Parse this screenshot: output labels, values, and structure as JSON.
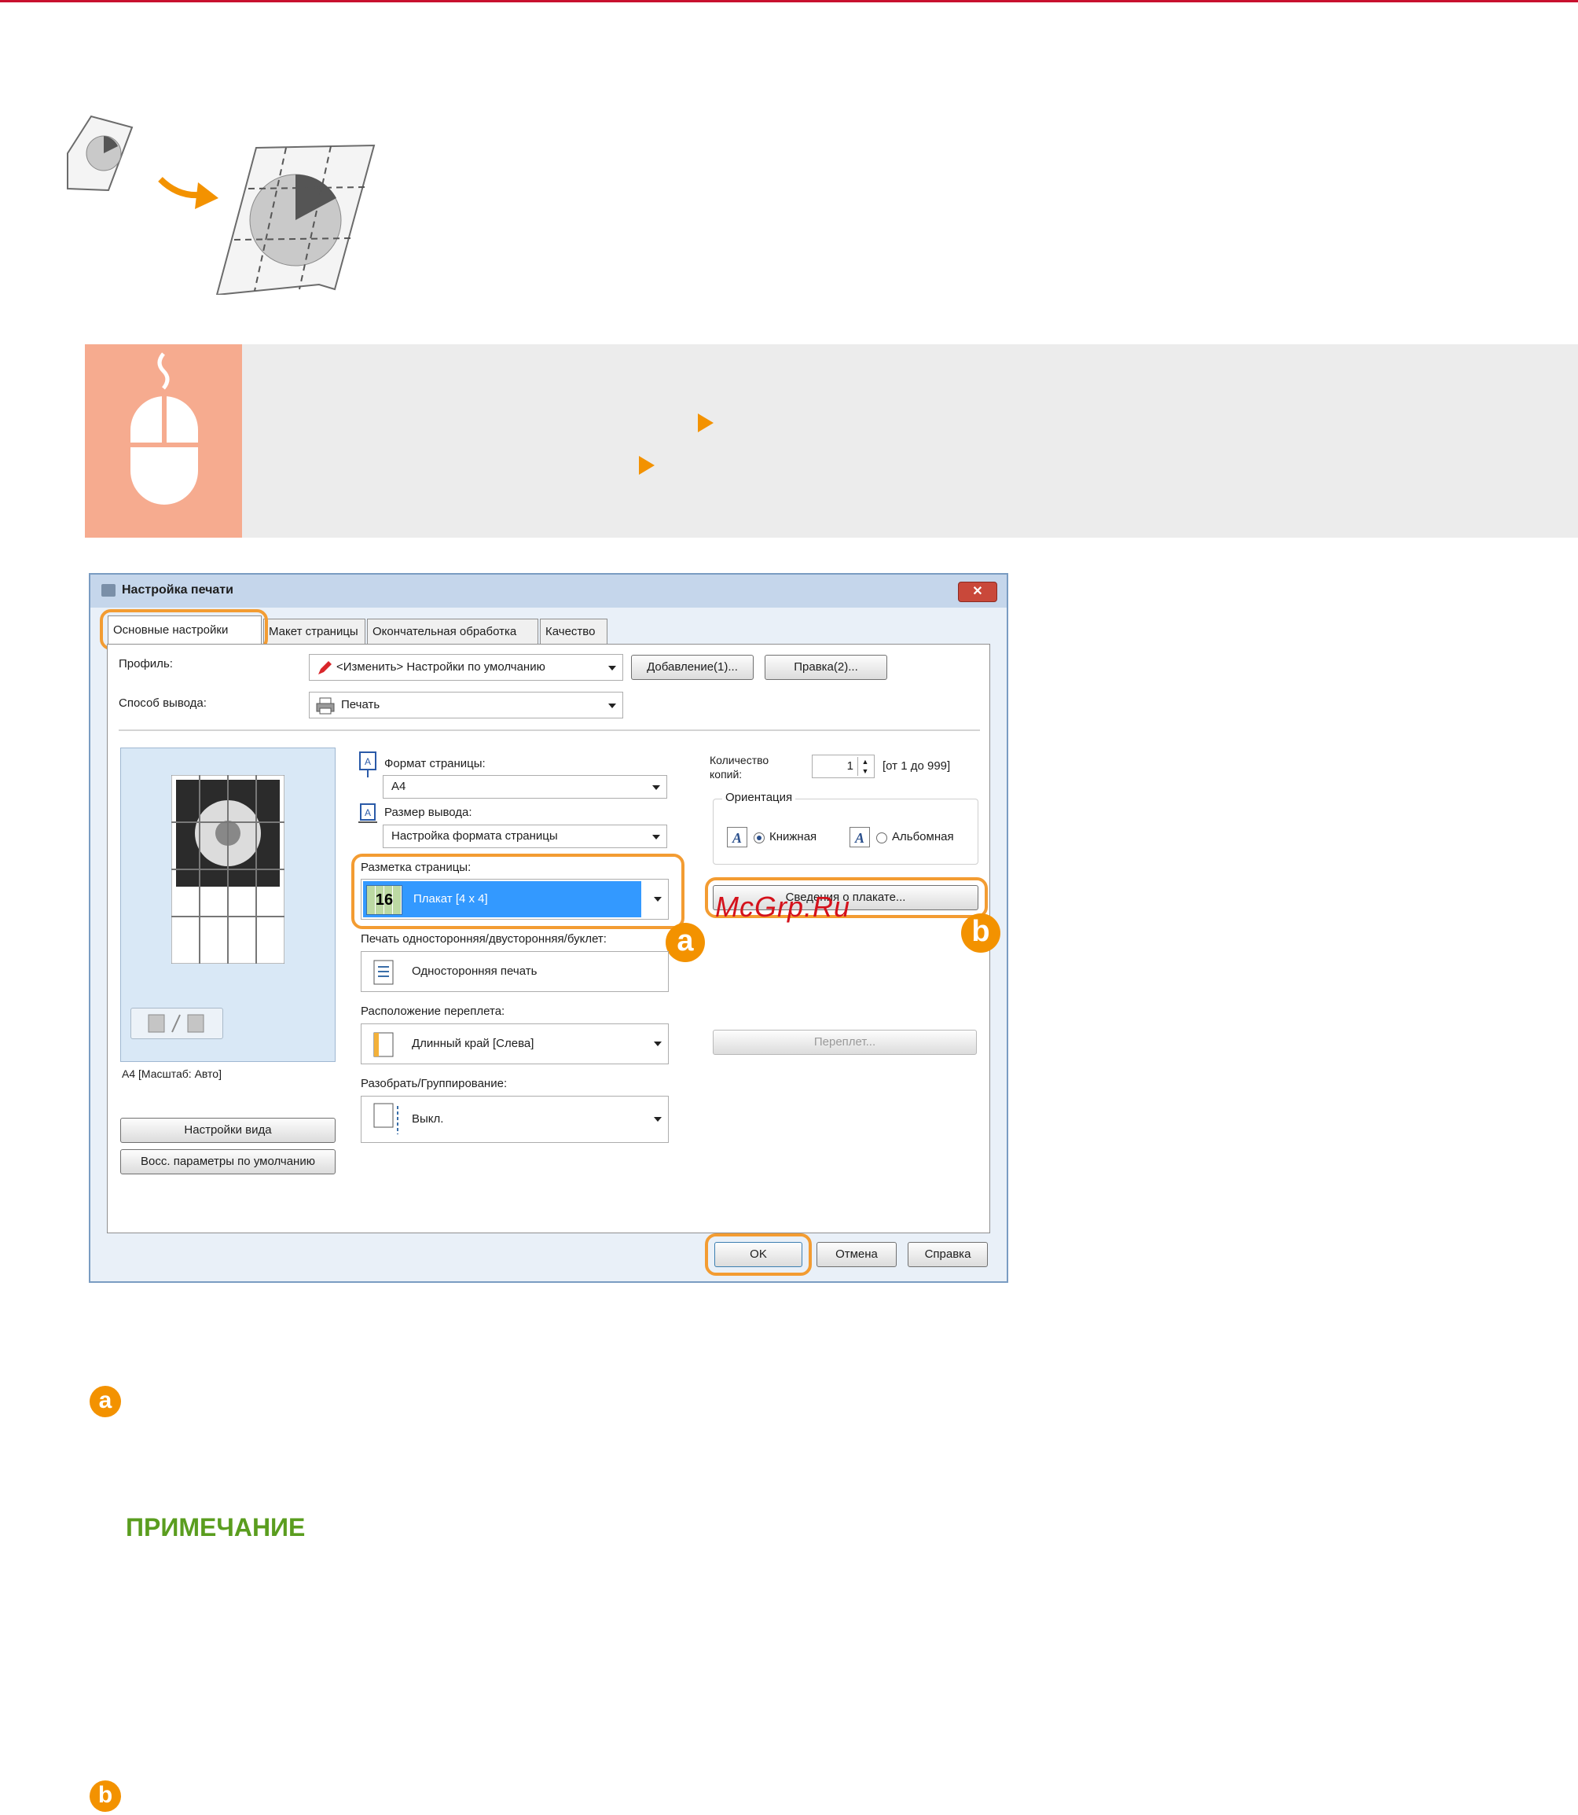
{
  "dialog": {
    "title": "Настройка печати",
    "close_label": "✕",
    "tabs": [
      {
        "label": "Основные настройки"
      },
      {
        "label": "Макет страницы"
      },
      {
        "label": "Окончательная обработка"
      },
      {
        "label": "Качество"
      }
    ],
    "profile": {
      "label": "Профиль:",
      "value": "<Изменить> Настройки по умолчанию",
      "add_button": "Добавление(1)...",
      "edit_button": "Правка(2)..."
    },
    "output_method": {
      "label": "Способ вывода:",
      "value": "Печать"
    },
    "page_size": {
      "label": "Формат страницы:",
      "value": "A4"
    },
    "output_size": {
      "label": "Размер вывода:",
      "value": "Настройка формата страницы"
    },
    "copies": {
      "label": "Количество копий:",
      "value": "1",
      "range": "[от 1 до 999]"
    },
    "orientation": {
      "label": "Ориентация",
      "portrait": "Книжная",
      "landscape": "Альбомная"
    },
    "page_layout": {
      "label": "Разметка страницы:",
      "value": "Плакат [4 x 4]",
      "icon_text": "16"
    },
    "poster_details_button": "Сведения о плакате...",
    "print_style": {
      "label": "Печать односторонняя/двусторонняя/буклет:",
      "value": "Односторонняя печать"
    },
    "binding_location": {
      "label": "Расположение переплета:",
      "value": "Длинный край [Слева]"
    },
    "binding_button": "Переплет...",
    "collate": {
      "label": "Разобрать/Группирование:",
      "value": "Выкл."
    },
    "preview_caption": "A4 [Масштаб: Авто]",
    "view_settings_button": "Настройки вида",
    "restore_defaults_button": "Восс. параметры по умолчанию",
    "ok_button": "OK",
    "cancel_button": "Отмена",
    "help_button": "Справка"
  },
  "callouts": {
    "a": "a",
    "b": "b"
  },
  "watermark": "McGrp.Ru",
  "note_heading": "ПРИМЕЧАНИЕ",
  "colors": {
    "accent": "#f39200",
    "banner_icon": "#f6ab8f",
    "note_green": "#5a9d1f",
    "top_rule": "#c8102e"
  }
}
